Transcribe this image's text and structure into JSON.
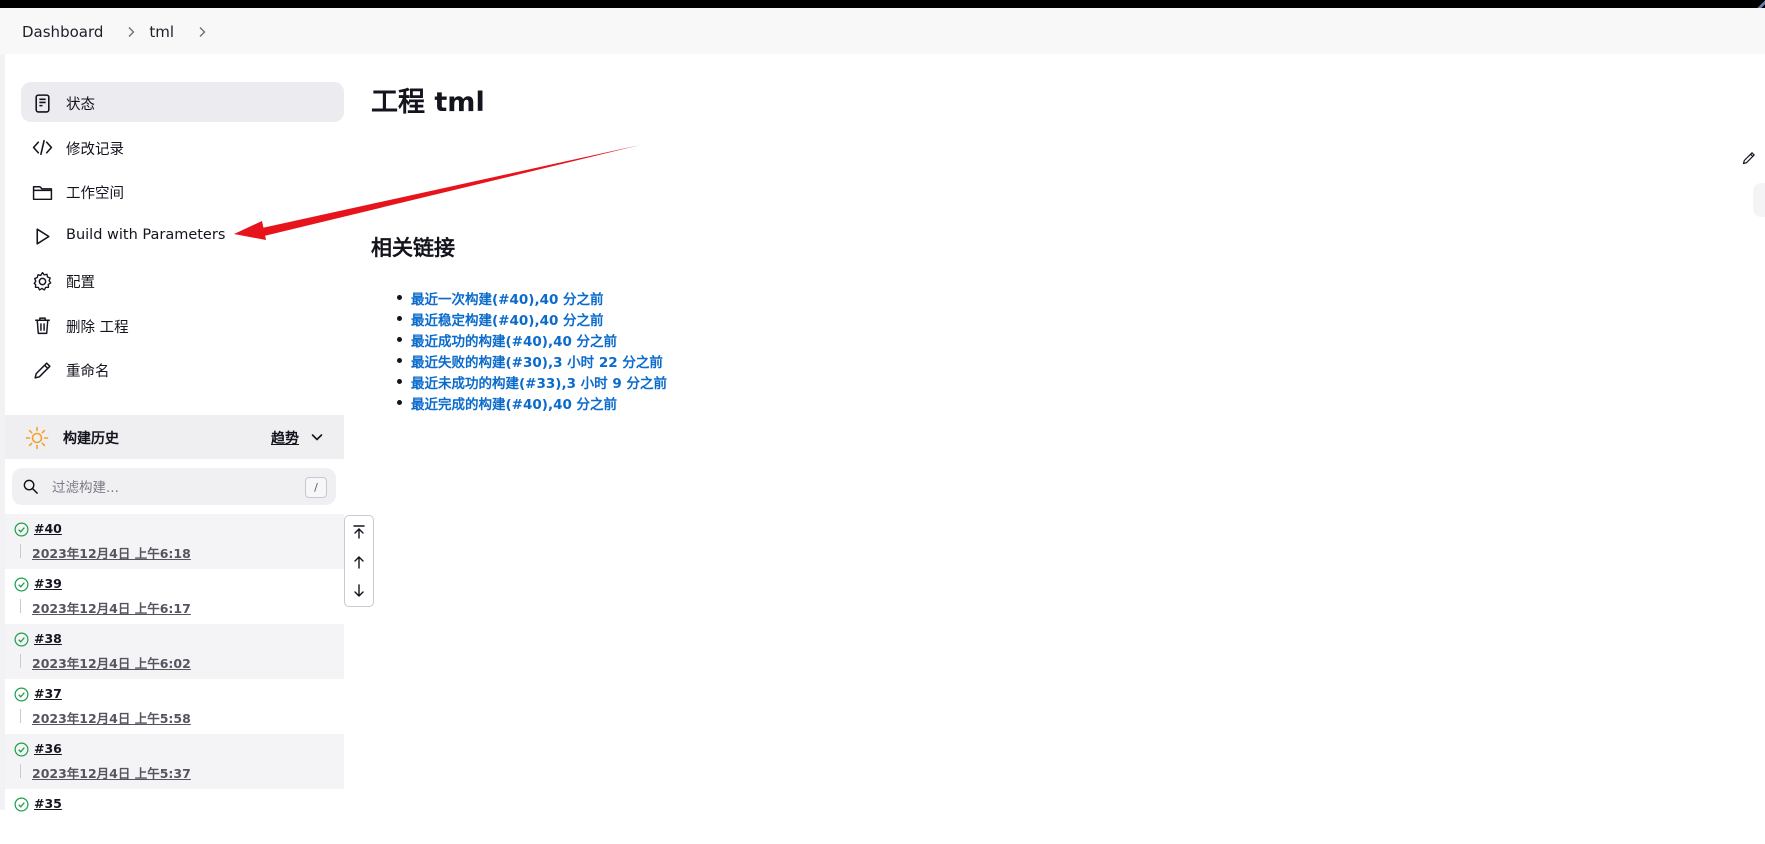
{
  "breadcrumb": {
    "items": [
      "Dashboard",
      "tml"
    ]
  },
  "sidebar": {
    "items": [
      {
        "label": "状态",
        "icon": "status-icon"
      },
      {
        "label": "修改记录",
        "icon": "code-icon"
      },
      {
        "label": "工作空间",
        "icon": "folder-icon"
      },
      {
        "label": "Build with Parameters",
        "icon": "play-icon"
      },
      {
        "label": "配置",
        "icon": "gear-icon"
      },
      {
        "label": "删除 工程",
        "icon": "trash-icon"
      },
      {
        "label": "重命名",
        "icon": "pencil-icon"
      }
    ]
  },
  "history": {
    "title": "构建历史",
    "trend_label": "趋势",
    "search_placeholder": "过滤构建...",
    "shortcut": "/",
    "builds": [
      {
        "number": "#40",
        "date": "2023年12月4日 上午6:18"
      },
      {
        "number": "#39",
        "date": "2023年12月4日 上午6:17"
      },
      {
        "number": "#38",
        "date": "2023年12月4日 上午6:02"
      },
      {
        "number": "#37",
        "date": "2023年12月4日 上午5:58"
      },
      {
        "number": "#36",
        "date": "2023年12月4日 上午5:37"
      },
      {
        "number": "#35",
        "date": ""
      }
    ]
  },
  "main": {
    "title": "工程 tml",
    "related_title": "相关链接",
    "links": [
      "最近一次构建(#40),40 分之前",
      "最近稳定构建(#40),40 分之前",
      "最近成功的构建(#40),40 分之前",
      "最近失败的构建(#30),3 小时 22 分之前",
      "最近未成功的构建(#33),3 小时 9 分之前",
      "最近完成的构建(#40),40 分之前"
    ]
  },
  "colors": {
    "link": "#0b6bcb",
    "success": "#1e9e4a",
    "annotation_arrow": "#e8141c",
    "sun": "#f2a12e"
  }
}
